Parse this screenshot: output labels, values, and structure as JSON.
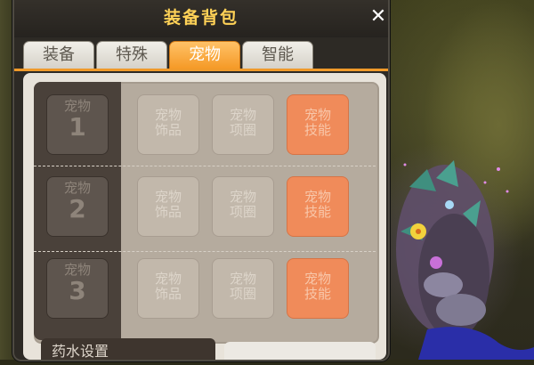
{
  "window": {
    "title": "装备背包",
    "close_symbol": "✕"
  },
  "tabs": [
    {
      "label": "装备",
      "active": false
    },
    {
      "label": "特殊",
      "active": false
    },
    {
      "label": "宠物",
      "active": true
    },
    {
      "label": "智能",
      "active": false
    }
  ],
  "pets": [
    {
      "pet_label": "宠物",
      "pet_number": "1",
      "accessory": "宠物\n饰品",
      "collar": "宠物\n项圈",
      "skill": "宠物\n技能"
    },
    {
      "pet_label": "宠物",
      "pet_number": "2",
      "accessory": "宠物\n饰品",
      "collar": "宠物\n项圈",
      "skill": "宠物\n技能"
    },
    {
      "pet_label": "宠物",
      "pet_number": "3",
      "accessory": "宠物\n饰品",
      "collar": "宠物\n项圈",
      "skill": "宠物\n技能"
    }
  ],
  "bottom": {
    "partial_label": "药水设置"
  },
  "colors": {
    "title": "#ffd257",
    "active_tab": "#f59a27",
    "skill_slot": "#f08b5a",
    "pet_slot": "#5e554e"
  }
}
